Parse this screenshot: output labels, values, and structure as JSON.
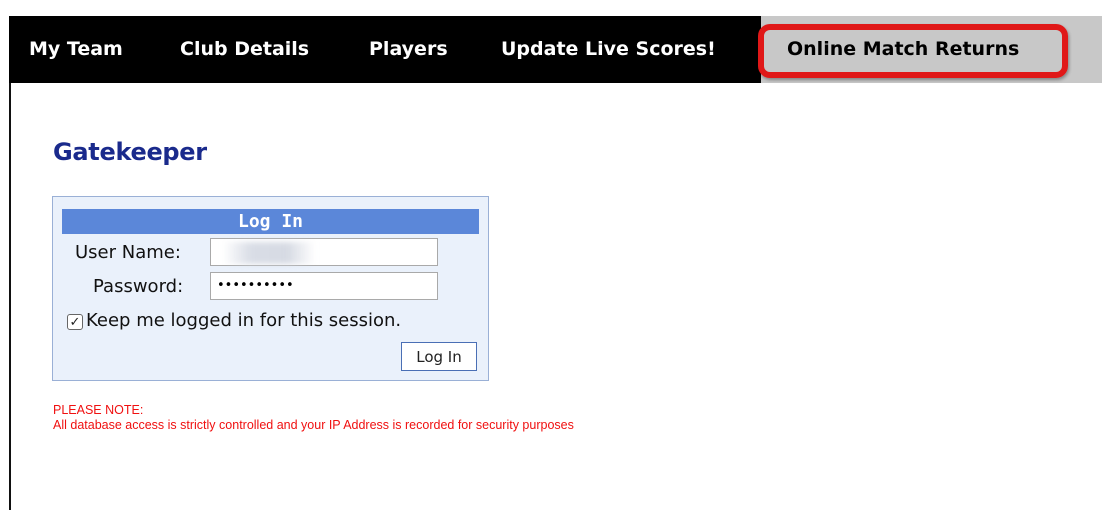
{
  "nav": {
    "items": [
      {
        "label": "My Team"
      },
      {
        "label": "Club Details"
      },
      {
        "label": "Players"
      },
      {
        "label": "Update Live Scores!"
      },
      {
        "label": "Online Match Returns",
        "highlighted": true
      }
    ]
  },
  "page": {
    "title": "Gatekeeper"
  },
  "login": {
    "header": "Log In",
    "username_label": "User Name:",
    "username_value": "",
    "password_label": "Password:",
    "password_value": "••••••••••",
    "keep_logged_in_label": "Keep me logged in for this session.",
    "keep_logged_in_checked": true,
    "checkmark": "✓",
    "submit_label": "Log In"
  },
  "notice": {
    "heading": "PLEASE NOTE:",
    "text": "All database access is strictly controlled and your IP Address is recorded for security purposes"
  },
  "colors": {
    "navbar": "#000000",
    "title": "#1a2a8c",
    "login_header": "#5b87d9",
    "notice": "#f01010",
    "callout": "#e01818"
  }
}
